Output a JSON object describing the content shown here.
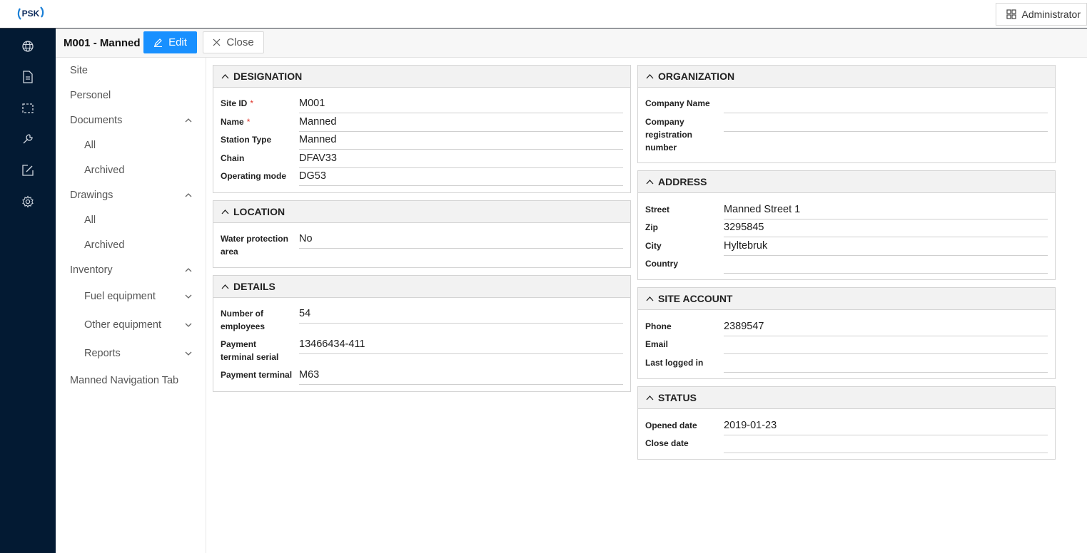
{
  "header": {
    "logo_text": "PSK",
    "user_button": "Administrator"
  },
  "toolbar": {
    "title": "M001 - Manned",
    "edit_label": "Edit",
    "close_label": "Close"
  },
  "rail": {
    "icons": [
      "globe-icon",
      "document-icon",
      "selection-icon",
      "wrench-icon",
      "edit-note-icon",
      "settings-icon"
    ]
  },
  "sidenav": {
    "items": [
      {
        "label": "Site"
      },
      {
        "label": "Personel"
      },
      {
        "label": "Documents"
      },
      {
        "label": "All"
      },
      {
        "label": "Archived"
      },
      {
        "label": "Drawings"
      },
      {
        "label": "All"
      },
      {
        "label": "Archived"
      },
      {
        "label": "Inventory"
      },
      {
        "label": "Fuel equipment"
      },
      {
        "label": "Other equipment"
      },
      {
        "label": "Reports"
      },
      {
        "label": "Manned Navigation Tab"
      }
    ]
  },
  "panels": {
    "designation": {
      "title": "DESIGNATION",
      "fields": [
        {
          "label": "Site ID",
          "required": "*",
          "value": "M001"
        },
        {
          "label": "Name",
          "required": "*",
          "value": "Manned"
        },
        {
          "label": "Station Type",
          "value": "Manned"
        },
        {
          "label": "Chain",
          "value": "DFAV33"
        },
        {
          "label": "Operating mode",
          "value": "DG53"
        }
      ]
    },
    "location": {
      "title": "LOCATION",
      "fields": [
        {
          "label": "Water protection area",
          "value": "No"
        }
      ]
    },
    "details": {
      "title": "DETAILS",
      "fields": [
        {
          "label": "Number of employees",
          "value": "54"
        },
        {
          "label": "Payment terminal serial",
          "value": "13466434-411"
        },
        {
          "label": "Payment terminal",
          "value": "M63"
        }
      ]
    },
    "organization": {
      "title": "ORGANIZATION",
      "fields": [
        {
          "label": "Company Name",
          "value": ""
        },
        {
          "label": "Company registration number",
          "value": ""
        }
      ]
    },
    "address": {
      "title": "ADDRESS",
      "fields": [
        {
          "label": "Street",
          "value": "Manned Street 1"
        },
        {
          "label": "Zip",
          "value": "3295845"
        },
        {
          "label": "City",
          "value": "Hyltebruk"
        },
        {
          "label": "Country",
          "value": ""
        }
      ]
    },
    "site_account": {
      "title": "SITE ACCOUNT",
      "fields": [
        {
          "label": "Phone",
          "value": "2389547"
        },
        {
          "label": "Email",
          "value": ""
        },
        {
          "label": "Last logged in",
          "value": ""
        }
      ]
    },
    "status": {
      "title": "STATUS",
      "fields": [
        {
          "label": "Opened date",
          "value": "2019-01-23"
        },
        {
          "label": "Close date",
          "value": ""
        }
      ]
    }
  },
  "colors": {
    "rail_bg": "#031a33",
    "primary": "#1890ff",
    "required": "#e0352b"
  }
}
